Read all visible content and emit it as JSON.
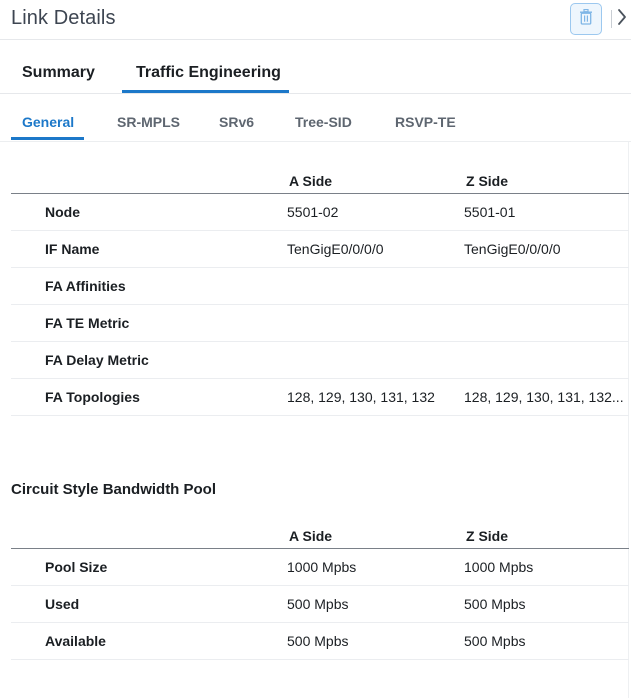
{
  "header": {
    "title": "Link Details"
  },
  "primary_tabs": [
    {
      "label": "Summary"
    },
    {
      "label": "Traffic Engineering",
      "active": true
    }
  ],
  "secondary_tabs": [
    {
      "label": "General",
      "active": true
    },
    {
      "label": "SR-MPLS"
    },
    {
      "label": "SRv6"
    },
    {
      "label": "Tree-SID"
    },
    {
      "label": "RSVP-TE"
    }
  ],
  "general_table": {
    "headers": {
      "label": "",
      "a_side": "A Side",
      "z_side": "Z Side"
    },
    "rows": [
      {
        "label": "Node",
        "a": "5501-02",
        "z": "5501-01"
      },
      {
        "label": "IF Name",
        "a": "TenGigE0/0/0/0",
        "z": "TenGigE0/0/0/0"
      },
      {
        "label": "FA Affinities",
        "a": "",
        "z": ""
      },
      {
        "label": "FA TE Metric",
        "a": "",
        "z": ""
      },
      {
        "label": "FA Delay Metric",
        "a": "",
        "z": ""
      },
      {
        "label": "FA Topologies",
        "a": "128, 129, 130, 131, 132",
        "z": "128, 129, 130, 131, 132..."
      }
    ]
  },
  "bandwidth_pool": {
    "title": "Circuit Style Bandwidth Pool",
    "headers": {
      "label": "",
      "a_side": "A Side",
      "z_side": "Z Side"
    },
    "rows": [
      {
        "label": "Pool Size",
        "a": "1000 Mpbs",
        "z": "1000 Mpbs"
      },
      {
        "label": "Used",
        "a": "500 Mpbs",
        "z": "500 Mpbs"
      },
      {
        "label": "Available",
        "a": "500 Mpbs",
        "z": "500 Mpbs"
      }
    ]
  },
  "icons": {
    "delete": "trash-icon",
    "expand": "chevron-right-icon"
  },
  "colors": {
    "accent": "#1c78c9",
    "text": "#1b1f23",
    "muted_tab": "#5e6670",
    "delete_border": "#9cc8ef"
  }
}
